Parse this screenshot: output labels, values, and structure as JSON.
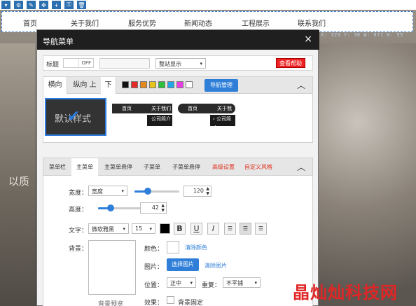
{
  "toolbar": {
    "icons": [
      "chevron-down-icon",
      "gear-icon",
      "pencil-icon",
      "move-icon",
      "plus-icon",
      "lock-icon",
      "trash-icon"
    ]
  },
  "navbar": {
    "items": [
      "首页",
      "关于我们",
      "服务优势",
      "新闻动态",
      "工程展示",
      "联系我们"
    ]
  },
  "coords": "X: 329  Y: 30  W: 871  H: 55",
  "background_text": "以质",
  "watermark": "晶灿灿科技网",
  "dialog": {
    "title": "导航菜单",
    "close": "×",
    "row1": {
      "title_label": "标题",
      "toggle": "OFF",
      "display_select": "整站显示",
      "help_button": "查看帮助"
    },
    "tabs": [
      "横向",
      "纵向 上",
      "下"
    ],
    "swatches": [
      "#111111",
      "#e62727",
      "#e68a1e",
      "#e8c51d",
      "#2dbf3a",
      "#22a6e6",
      "#e63ee0",
      "#ffffff"
    ],
    "nav_manage_button": "导航管理",
    "style_cards": {
      "default_label": "默认样式",
      "card2_items": [
        "首页",
        "关于我们",
        "公司简介"
      ],
      "card3_items": [
        "首页",
        "关于我们",
        "公司简介"
      ]
    },
    "tabs2": [
      "菜单栏",
      "主菜单",
      "主菜单悬停",
      "子菜单",
      "子菜单悬停",
      "高级设置",
      "自定义风格"
    ],
    "panel": {
      "width_label": "宽度：",
      "width_select": "宽度",
      "width_value": "120",
      "width_slider": 0.3,
      "height_label": "高度：",
      "height_value": "42",
      "height_slider": 0.28,
      "text_label": "文字：",
      "font_select": "微软雅黑",
      "font_size": "15",
      "text_color": "#000000",
      "format_buttons": [
        "B",
        "U",
        "I"
      ],
      "bg_label": "背景：",
      "preview_label": "背景预览",
      "color_label": "颜色：",
      "clear_color": "清除颜色",
      "image_label": "图片：",
      "choose_image": "选择图片",
      "clear_image": "清除图片",
      "position_label": "位置：",
      "position_select": "正中",
      "repeat_label": "重复：",
      "repeat_select": "不平铺",
      "effect_label": "效果：",
      "fixed_label": "背景固定"
    }
  }
}
